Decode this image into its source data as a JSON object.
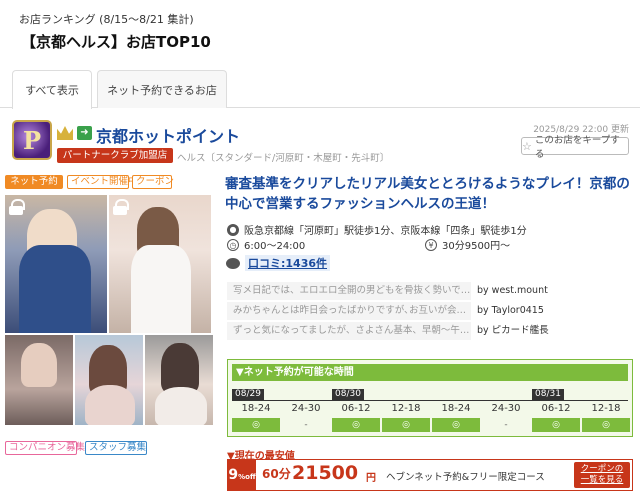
{
  "ranking": {
    "period": "お店ランキング (8/15～8/21 集計)",
    "title": "【京都ヘルス】お店TOP10"
  },
  "tabs": [
    {
      "label": "すべて表示",
      "active": true
    },
    {
      "label": "ネット予約できるお店",
      "active": false
    }
  ],
  "shop": {
    "logo_letter": "P",
    "name": "京都ホットポイント",
    "partner": "パートナークラブ加盟店",
    "genre": "ヘルス〔スタンダード/河原町・木屋町・先斗町〕",
    "updated": "2025/8/29 22:00 更新",
    "keep_label": "このお店をキープする",
    "badges": [
      "ネット予約",
      "イベント開催中",
      "クーポン"
    ],
    "catch": "審査基準をクリアしたリアル美女ととろけるようなプレイ！京都の中心で営業するファッションヘルスの王道！",
    "access": "阪急京都線「河原町」駅徒歩1分、京阪本線「四条」駅徒歩1分",
    "hours": "6:00～24:00",
    "price": "30分9500円～",
    "review_link": "口コミ:1436件",
    "foot_badges": [
      "コンパニオン募集",
      "スタッフ募集"
    ]
  },
  "reviews": [
    {
      "text": "写メ日記では、エロエロ全開の男どもを骨抜く勢いで…",
      "by": "by west.mount"
    },
    {
      "text": "みかちゃんとは昨日会ったばかりですが､お互いが会…",
      "by": "by Taylor0415"
    },
    {
      "text": "ずっと気になってましたが、さよさん基本、早朝～午…",
      "by": "by ピカード艦長"
    }
  ],
  "reserve": {
    "heading": "▼ネット予約が可能な時間",
    "dates": [
      {
        "label": "08/29",
        "col": 0
      },
      {
        "label": "08/30",
        "col": 2
      },
      {
        "label": "08/31",
        "col": 6
      }
    ],
    "times": [
      "18-24",
      "24-30",
      "06-12",
      "12-18",
      "18-24",
      "24-30",
      "06-12",
      "12-18"
    ],
    "cells": [
      "◎",
      "-",
      "◎",
      "◎",
      "◎",
      "-",
      "◎",
      "◎"
    ]
  },
  "deal": {
    "label": "▼現在の最安値",
    "off": "9",
    "off_unit": "%off",
    "minutes": "60分",
    "price": "21500",
    "yen": "円",
    "course": "ヘブンネット予約&フリー限定コース",
    "btn_line1": "クーポンの",
    "btn_line2": "一覧を見る"
  },
  "colors": {
    "brand_blue": "#1a4a9c",
    "accent_orange": "#f08a24",
    "reserve_green": "#7dbb3c",
    "deal_red": "#c7361a"
  }
}
